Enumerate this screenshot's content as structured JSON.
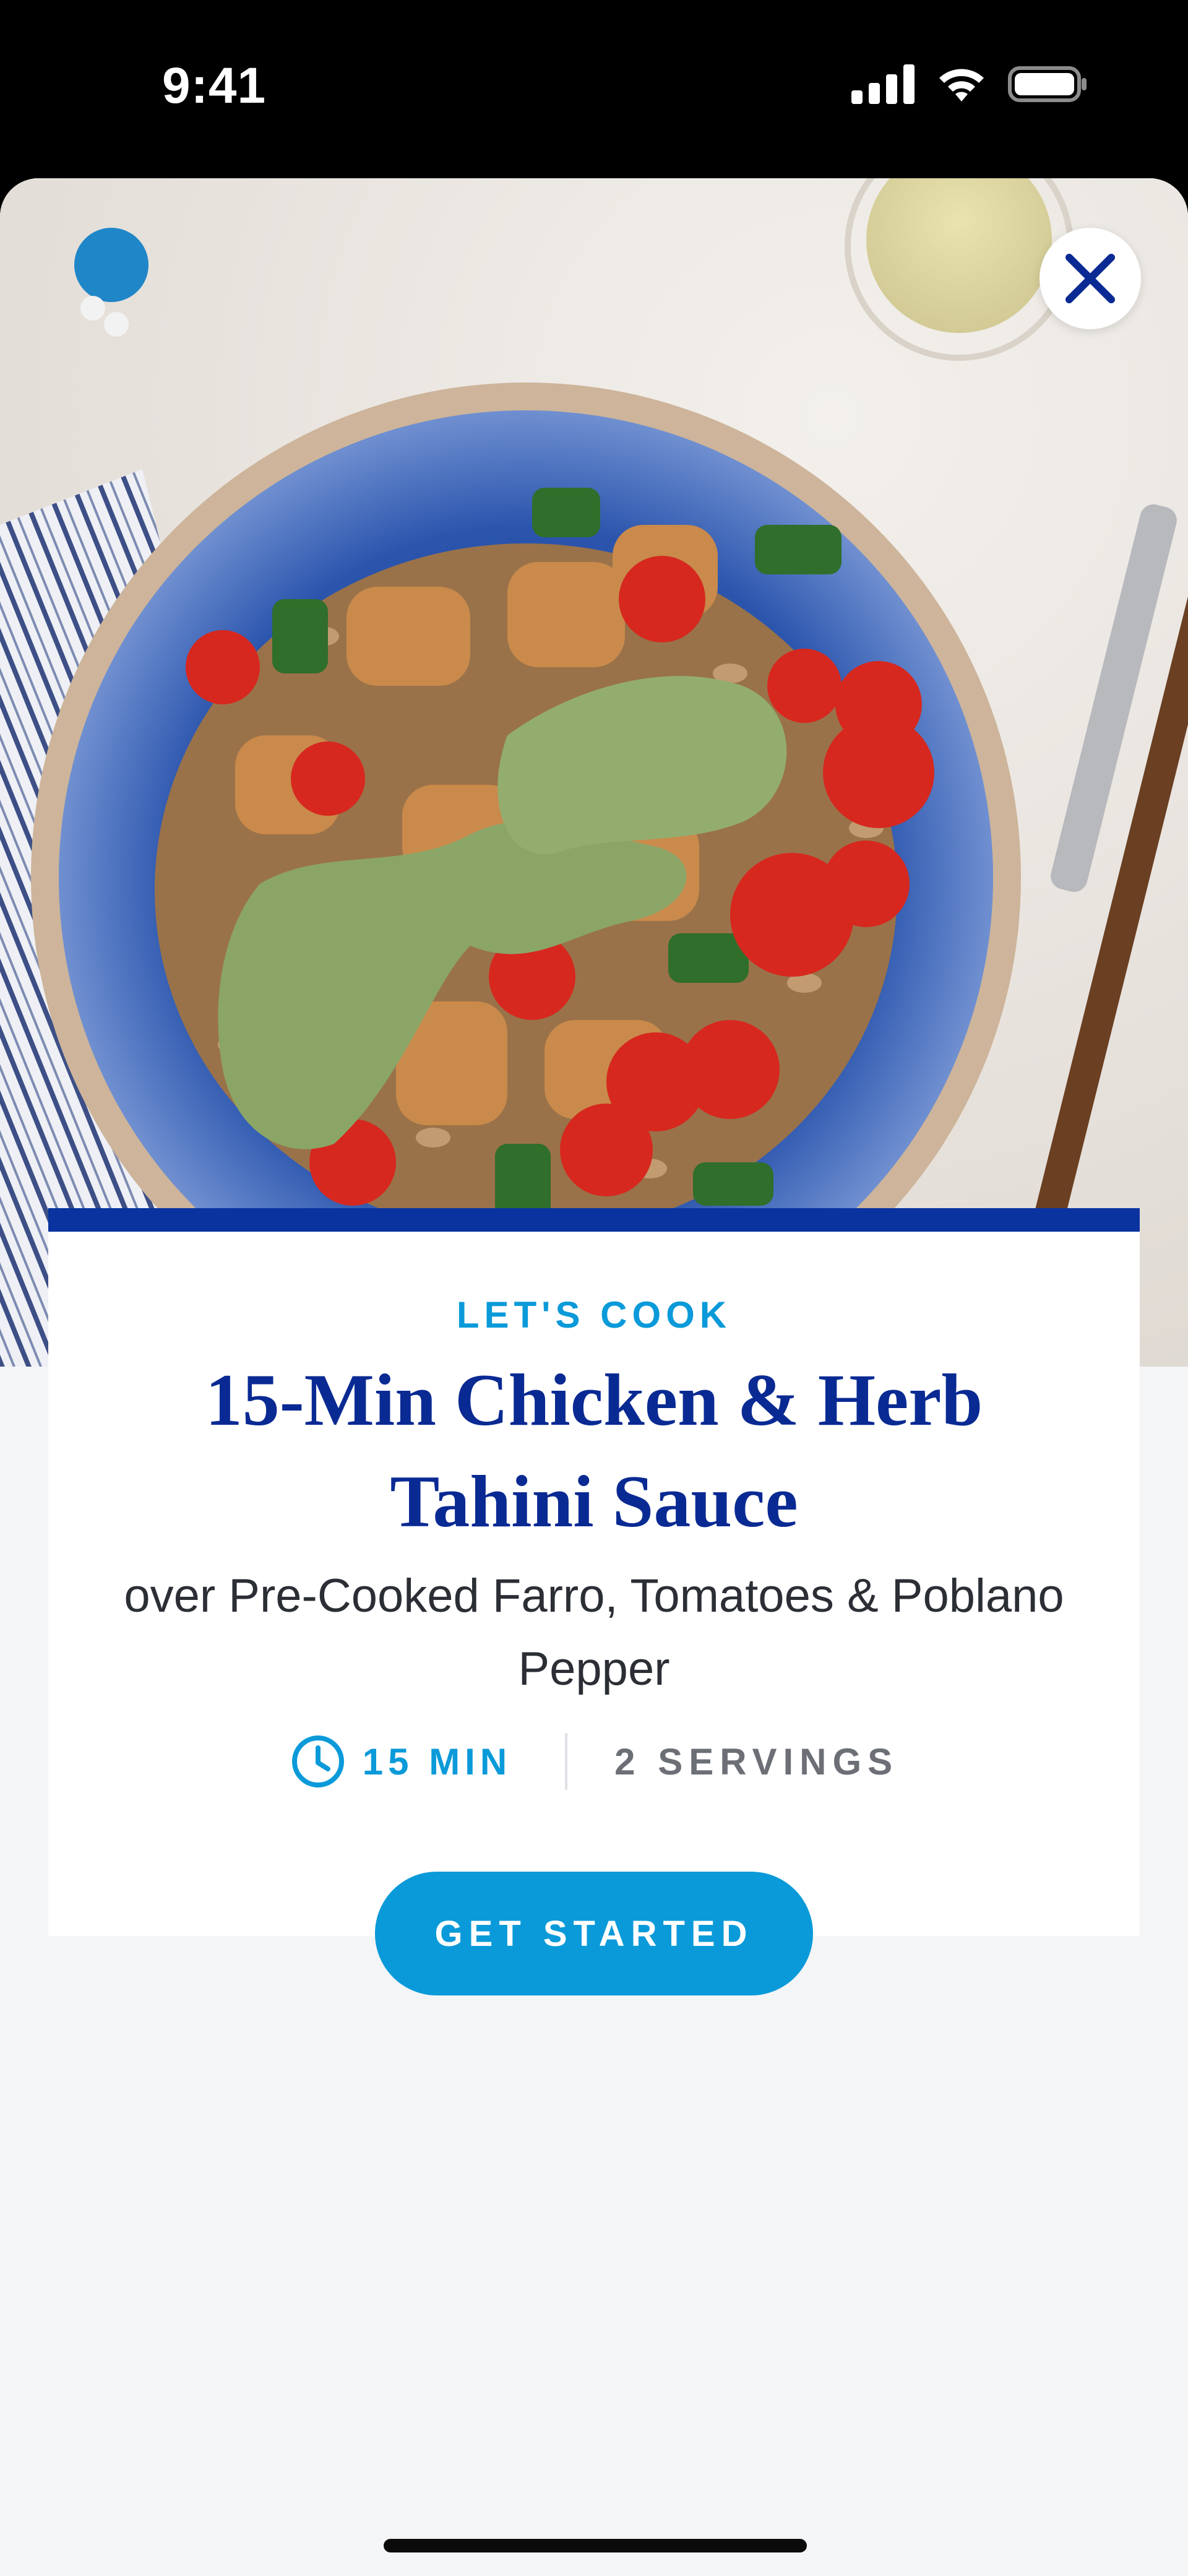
{
  "status_bar": {
    "time": "9:41"
  },
  "hero": {
    "icons": [
      "close-icon"
    ],
    "colors": {
      "plate_rim": "#2f56a8",
      "background": "#e8e3de"
    }
  },
  "card": {
    "eyebrow": "LET'S COOK",
    "title": "15-Min Chicken &  Herb Tahini Sauce",
    "subtitle": "over Pre-Cooked Farro, Tomatoes & Poblano Pepper",
    "time": "15 MIN",
    "servings": "2 SERVINGS",
    "icons": [
      "clock-icon"
    ],
    "colors": {
      "accent": "#0a9ad9",
      "title": "#0a2a93",
      "band": "#0a33a0"
    }
  },
  "cta": {
    "label": "GET STARTED"
  }
}
